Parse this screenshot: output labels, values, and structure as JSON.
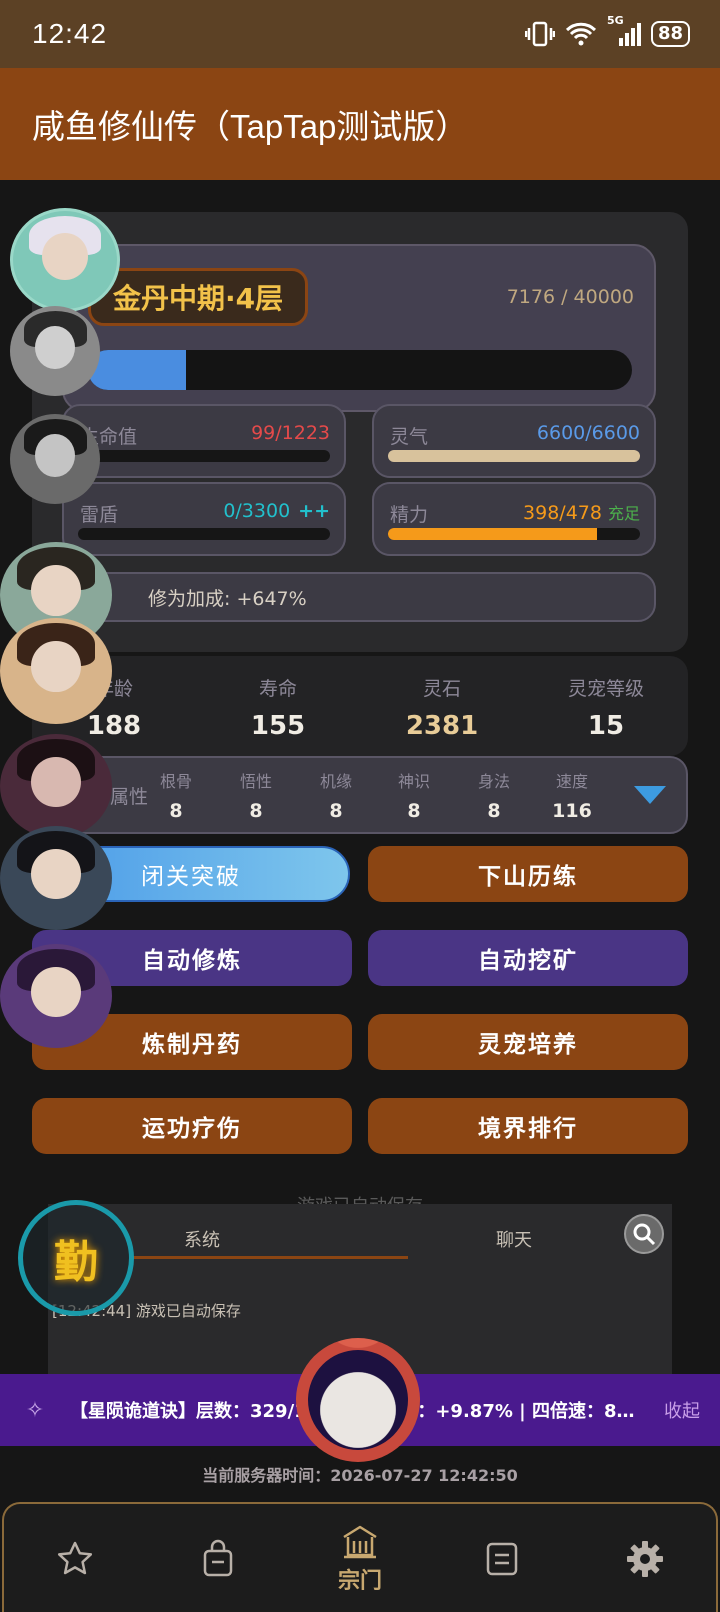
{
  "status_bar": {
    "time": "12:42",
    "network": "5G",
    "battery": "88"
  },
  "header": {
    "title": "咸鱼修仙传（TapTap测试版）"
  },
  "realm": {
    "name": "金丹中期·4层",
    "exp_text": "7176 / 40000",
    "exp_fraction": 0.18
  },
  "stats": {
    "hp": {
      "label": "生命值",
      "value": "99/1223",
      "color": "#e54a4a",
      "fraction": 0.02,
      "bar_color": "#e54a4a"
    },
    "spirit": {
      "label": "灵气",
      "value": "6600/6600",
      "color": "#5a9ae8",
      "fraction": 1.0,
      "bar_color": "#d8c29c"
    },
    "shield": {
      "label": "雷盾",
      "value": "0/3300",
      "extra": "++",
      "color": "#22c0cc",
      "fraction": 0.0,
      "bar_color": "#22c0cc"
    },
    "energy": {
      "label": "精力",
      "value": "398/478",
      "extra": "充足",
      "color": "#f59a1a",
      "extra_color": "#4cb04c",
      "fraction": 0.83,
      "bar_color": "#f59a1a"
    }
  },
  "bonus": {
    "text": "修为加成: +647%"
  },
  "info": [
    {
      "label": "年龄",
      "value": "188"
    },
    {
      "label": "寿命",
      "value": "155"
    },
    {
      "label": "灵石",
      "value": "2381"
    },
    {
      "label": "灵宠等级",
      "value": "15"
    }
  ],
  "attributes": {
    "head": "属性",
    "items": [
      {
        "label": "根骨",
        "value": "8"
      },
      {
        "label": "悟性",
        "value": "8"
      },
      {
        "label": "机缘",
        "value": "8"
      },
      {
        "label": "神识",
        "value": "8"
      },
      {
        "label": "身法",
        "value": "8"
      },
      {
        "label": "速度",
        "value": "116"
      }
    ]
  },
  "actions": {
    "retreat": "闭关突破",
    "train": "下山历练",
    "auto_cultivate": "自动修炼",
    "auto_mine": "自动挖矿",
    "alchemy": "炼制丹药",
    "pet": "灵宠培养",
    "heal": "运功疗伤",
    "ranking": "境界排行"
  },
  "log": {
    "autosave_notice": "游戏已自动保存",
    "tabs": [
      "系统",
      "聊天"
    ],
    "entries": [
      "[12:42:44] 游戏已自动保存"
    ]
  },
  "diligent_badge": "勤",
  "buff": {
    "text": "【星陨诡道诀】层数：329/1000 | 暴击率：+9.87% | 四倍速：80...",
    "collapse": "收起"
  },
  "server_time": "当前服务器时间：2026-07-27 12:42:50",
  "nav": {
    "items": [
      {
        "icon": "star-icon",
        "label": ""
      },
      {
        "icon": "bag-icon",
        "label": ""
      },
      {
        "icon": "sect-icon",
        "label": "宗门"
      },
      {
        "icon": "document-icon",
        "label": ""
      },
      {
        "icon": "gear-icon",
        "label": ""
      }
    ]
  }
}
